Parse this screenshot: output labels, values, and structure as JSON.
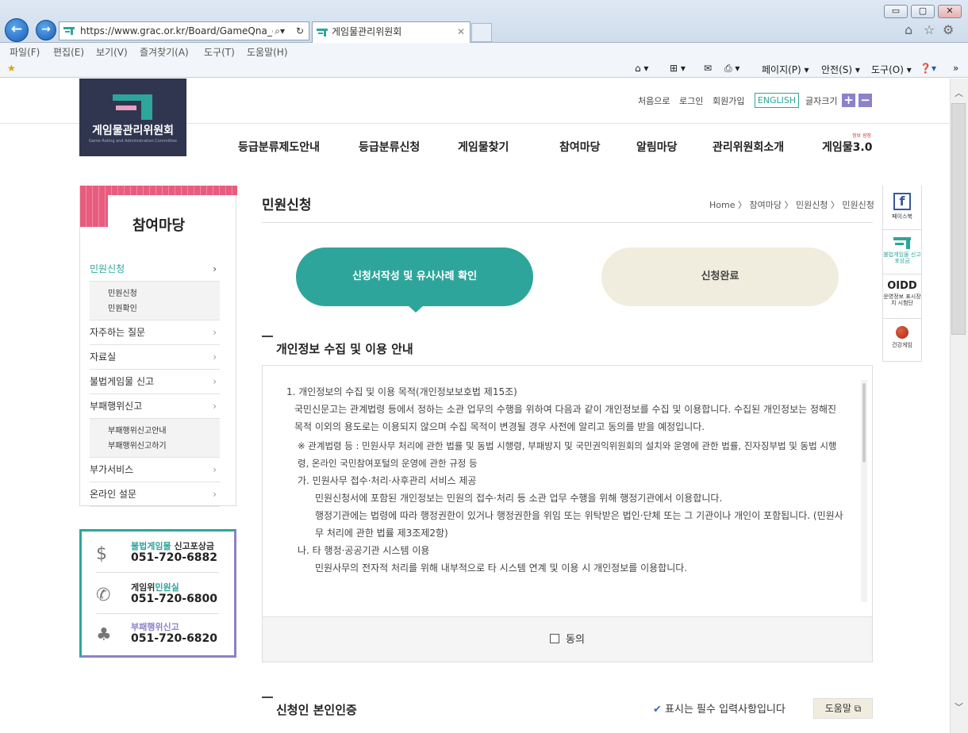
{
  "browser": {
    "url": "https://www.grac.or.kr/Board/GameQna_eP",
    "tab_title": "게임물관리위원회",
    "menu": [
      "파일(F)",
      "편집(E)",
      "보기(V)",
      "즐겨찾기(A)",
      "도구(T)",
      "도움말(H)"
    ],
    "commands": {
      "page": "페이지(P)",
      "safety": "안전(S)",
      "tools": "도구(O)"
    },
    "winbtns": {
      "min": "▭",
      "max": "▢",
      "close": "✕"
    }
  },
  "header": {
    "logo_text": "게임물관리위원회",
    "logo_sub": "Game Rating and Administration Committee",
    "util": {
      "home": "처음으로",
      "login": "로그인",
      "join": "회원가입",
      "english": "ENGLISH",
      "font_size": "글자크기",
      "plus": "+",
      "minus": "−"
    },
    "gnb": [
      "등급분류제도안내",
      "등급분류신청",
      "게임물찾기",
      "참여마당",
      "알림마당",
      "관리위원회소개",
      "게임물3.0"
    ],
    "gnb_badge": "정보 광장"
  },
  "lnb": {
    "title": "참여마당",
    "items": [
      {
        "label": "민원신청",
        "arrow": "›",
        "subs": [
          "민원신청",
          "민원확인"
        ]
      },
      {
        "label": "자주하는 질문",
        "arrow": "›"
      },
      {
        "label": "자료실",
        "arrow": "›"
      },
      {
        "label": "불법게임물 신고",
        "arrow": "›"
      },
      {
        "label": "부패행위신고",
        "arrow": "›",
        "subs": [
          "부패행위신고안내",
          "부패행위신고하기"
        ]
      },
      {
        "label": "부가서비스",
        "arrow": "›"
      },
      {
        "label": "온라인 설문",
        "arrow": "›"
      }
    ]
  },
  "contacts": [
    {
      "icon": "money-hand-icon",
      "label_a": "불법게임물",
      "label_b": " 신고포상금",
      "phone": "051-720-6882"
    },
    {
      "icon": "phone-icon",
      "label_a": "게임위",
      "label_b": "민원실",
      "phone": "051-720-6800"
    },
    {
      "icon": "clover-icon",
      "label_a": "부패행위신고",
      "label_b": "",
      "phone": "051-720-6820"
    }
  ],
  "content": {
    "title": "민원신청",
    "breadcrumb": "Home 〉 참여마당 〉 민원신청 〉 민원신청",
    "step_active": "신청서작성 및 유사사례 확인",
    "step_done": "신청완료",
    "privacy_heading": "개인정보 수집 및 이용 안내",
    "privacy_lines": [
      "1. 개인정보의 수집 및 이용 목적(개인정보보호법 제15조)",
      "국민신문고는 관계법령 등에서 정하는 소관 업무의 수행을 위하여 다음과 같이 개인정보를 수집 및 이용합니다. 수집된 개인정보는 정해진 목적 이외의 용도로는 이용되지 않으며 수집 목적이 변경될 경우 사전에 알리고 동의를 받을 예정입니다.",
      "※ 관계법령 등 : 민원사무 처리에 관한 법률 및 동법 시행령, 부패방지 및 국민권익위원회의 설치와 운영에 관한 법률, 진자징부법 및 동법 시행령, 온라인 국민참여포털의 운영에 관한 규정 등",
      "가. 민원사무 접수·처리·사후관리 서비스 제공",
      "민원신청서에 포함된 개인정보는 민원의 접수·처리 등 소관 업무 수행을 위해 행정기관에서 이용합니다.",
      "행정기관에는 법령에 따라 행정권한이 있거나 행정권한을 위임 또는 위탁받은 법인·단체 또는 그 기관이나 개인이 포함됩니다. (민원사무 처리에 관한 법률 제3조제2항)",
      "나. 타 행정·공공기관 시스템 이용",
      "민원사무의 전자적 처리를 위해 내부적으로 타 시스템 연계 및 이용 시 개인정보를 이용합니다."
    ],
    "agree_label": "동의",
    "auth_heading": "신청인 본인인증",
    "required_note": "표시는 필수 입력사항입니다",
    "help_label": "도움말"
  },
  "quick": [
    {
      "icon": "facebook-icon",
      "label": "페이스북"
    },
    {
      "icon": "grac-icon",
      "label": "불법게임물 신고포상금"
    },
    {
      "icon": "oidd-icon",
      "label": "운영정보 표시장치 시험단",
      "mark": "OIDD"
    },
    {
      "icon": "game-icon",
      "label": "건강게임"
    }
  ]
}
